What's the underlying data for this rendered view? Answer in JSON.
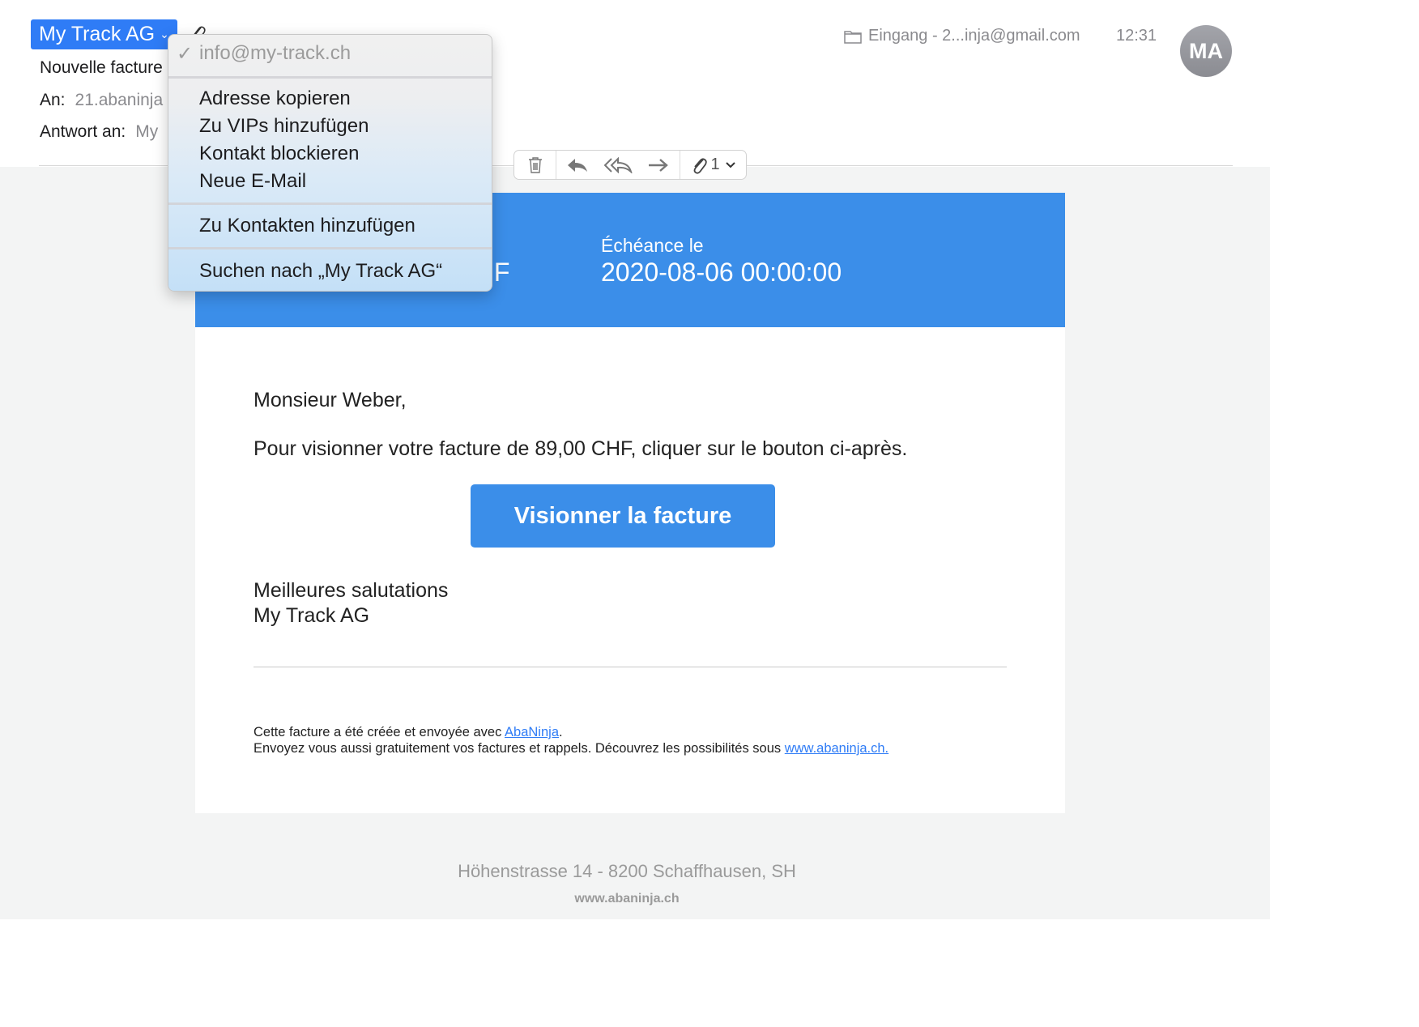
{
  "header": {
    "sender": "My Track AG",
    "subject": "Nouvelle facture",
    "to_label": "An:",
    "to_value": "21.abaninja",
    "reply_label": "Antwort an:",
    "reply_value": "My",
    "mailbox": "Eingang - 2...inja@gmail.com",
    "time": "12:31",
    "avatar_initials": "MA"
  },
  "toolbar": {
    "attachment_count": "1",
    "icons": [
      "trash-icon",
      "reply-icon",
      "reply-all-icon",
      "forward-icon",
      "paperclip-icon",
      "chevron-down-icon"
    ]
  },
  "menu": {
    "address": "info@my-track.ch",
    "items": [
      "Adresse kopieren",
      "Zu VIPs hinzufügen",
      "Kontakt blockieren",
      "Neue E-Mail"
    ],
    "add_contact": "Zu Kontakten hinzufügen",
    "search": "Suchen nach „My Track AG“"
  },
  "email": {
    "banner_amount_fragment": "IF",
    "due_label": "Échéance le",
    "due_value": "2020-08-06 00:00:00",
    "greeting": "Monsieur Weber,",
    "intro": "Pour visionner votre facture de 89,00 CHF, cliquer sur le bouton ci-après.",
    "cta": "Visionner la facture",
    "closing_1": "Meilleures salutations",
    "closing_2": "My Track AG",
    "footer_1_prefix": "Cette facture a été créée et envoyée avec ",
    "footer_1_link": "AbaNinja",
    "footer_1_suffix": ".",
    "footer_2_prefix": "Envoyez vous aussi gratuitement vos factures et rappels. Découvrez les possibilités sous ",
    "footer_2_link": "www.abaninja.ch.",
    "address": "Höhenstrasse 14 - 8200 Schaffhausen, SH",
    "site": "www.abaninja.ch"
  },
  "colors": {
    "accent": "#2f7cf6",
    "banner": "#3b8ee9",
    "background": "#f3f4f4"
  }
}
